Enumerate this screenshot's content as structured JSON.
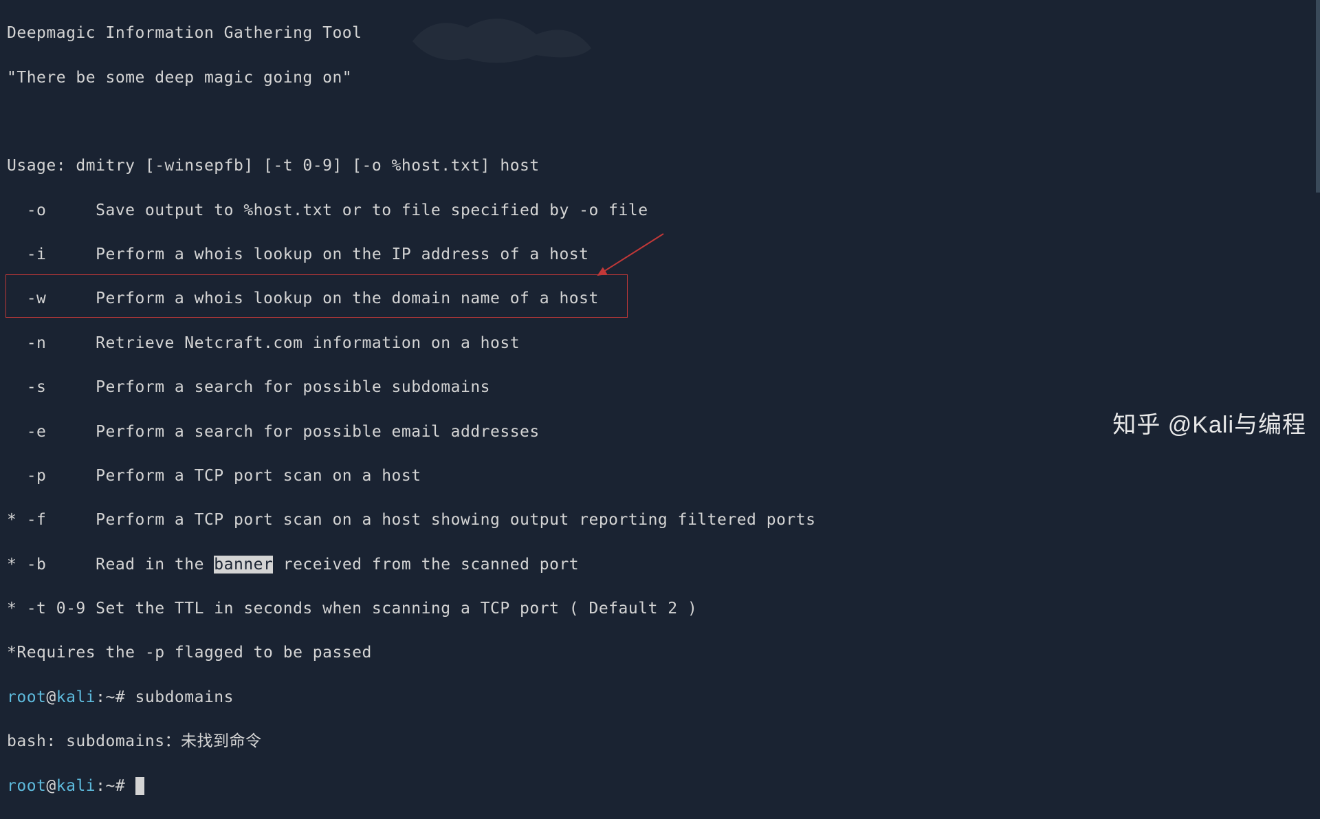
{
  "terminal": {
    "header_line1": "Deepmagic Information Gathering Tool",
    "header_line2": "\"There be some deep magic going on\"",
    "usage": "Usage: dmitry [-winsepfb] [-t 0-9] [-o %host.txt] host",
    "options": [
      {
        "flag": "  -o",
        "desc": "     Save output to %host.txt or to file specified by -o file"
      },
      {
        "flag": "  -i",
        "desc": "     Perform a whois lookup on the IP address of a host"
      },
      {
        "flag": "  -w",
        "desc": "     Perform a whois lookup on the domain name of a host"
      },
      {
        "flag": "  -n",
        "desc": "     Retrieve Netcraft.com information on a host"
      },
      {
        "flag": "  -s",
        "desc": "     Perform a search for possible subdomains"
      },
      {
        "flag": "  -e",
        "desc": "     Perform a search for possible email addresses"
      },
      {
        "flag": "  -p",
        "desc": "     Perform a TCP port scan on a host"
      },
      {
        "flag": "* -f",
        "desc": "     Perform a TCP port scan on a host showing output reporting filtered ports"
      }
    ],
    "banner_line": {
      "prefix": "* -b     Read in the ",
      "highlighted": "banner",
      "suffix": " received from the scanned port"
    },
    "ttl_line": "* -t 0-9 Set the TTL in seconds when scanning a TCP port ( Default 2 )",
    "requires_line": "*Requires the -p flagged to be passed",
    "prompt1": {
      "user": "root",
      "at": "@",
      "host": "kali",
      "path": ":~#",
      "command": " subdomains"
    },
    "error_line": "bash: subdomains：未找到命令",
    "prompt2": {
      "user": "root",
      "at": "@",
      "host": "kali",
      "path": ":~#",
      "command": " "
    }
  },
  "watermark": "知乎 @Kali与编程"
}
